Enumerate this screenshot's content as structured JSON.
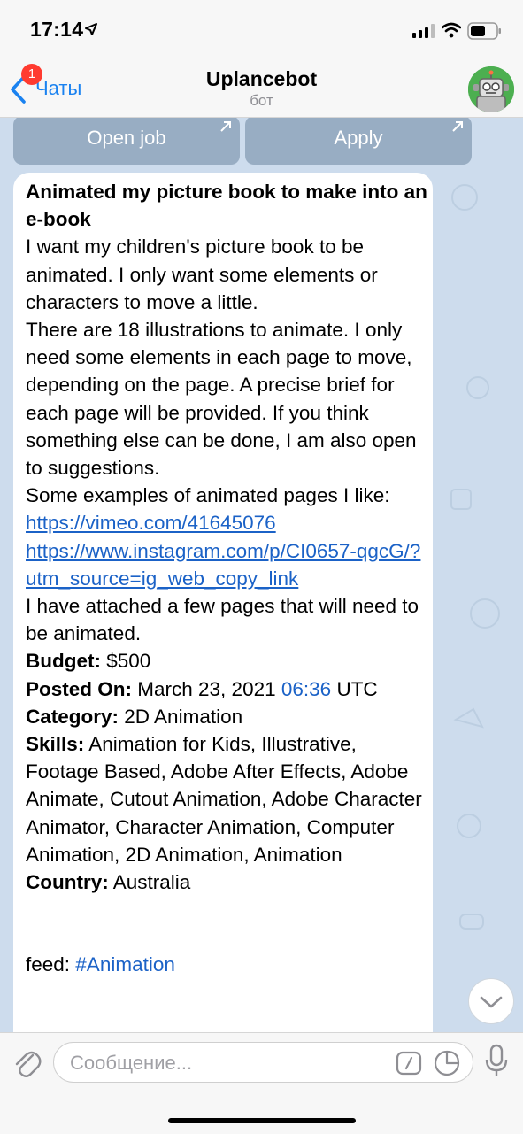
{
  "status_bar": {
    "time": "17:14"
  },
  "nav": {
    "back_label": "Чаты",
    "badge_count": "1",
    "title": "Uplancebot",
    "subtitle": "бот"
  },
  "inline_buttons": [
    {
      "label": "Open job"
    },
    {
      "label": "Apply"
    }
  ],
  "message": {
    "title": "Animated my picture book to make into an e-book",
    "paragraphs": [
      "I want my children's picture book to be animated. I only want some elements or characters to move a little.",
      "There are 18 illustrations to animate. I only need some elements in each page to move, depending on the page. A precise brief for each page will be provided. If you think something else can be done, I am also open to suggestions.",
      "Some examples of animated pages I like:"
    ],
    "links": [
      "https://vimeo.com/41645076",
      "https://www.instagram.com/p/CI0657-qgcG/?utm_source=ig_web_copy_link"
    ],
    "after_links": "I have attached a few pages that will need to be animated.",
    "budget_label": "Budget:",
    "budget_value": " $500",
    "posted_label": "Posted On:",
    "posted_date": " March 23, 2021 ",
    "posted_time": "06:36",
    "posted_tz": " UTC",
    "category_label": "Category:",
    "category_value": " 2D Animation",
    "skills_label": "Skills:",
    "skills_value": " Animation for Kids, Illustrative, Footage Based, Adobe After Effects, Adobe Animate, Cutout Animation, Adobe Character Animator, Character Animation, Computer Animation, 2D Animation, Animation",
    "country_label": "Country:",
    "country_value": " Australia",
    "feed_label": "feed: ",
    "feed_tag": "#Animation"
  },
  "input": {
    "placeholder": "Сообщение..."
  },
  "colors": {
    "accent": "#1a82f0",
    "link": "#1b62c7",
    "badge": "#ff3b30"
  }
}
